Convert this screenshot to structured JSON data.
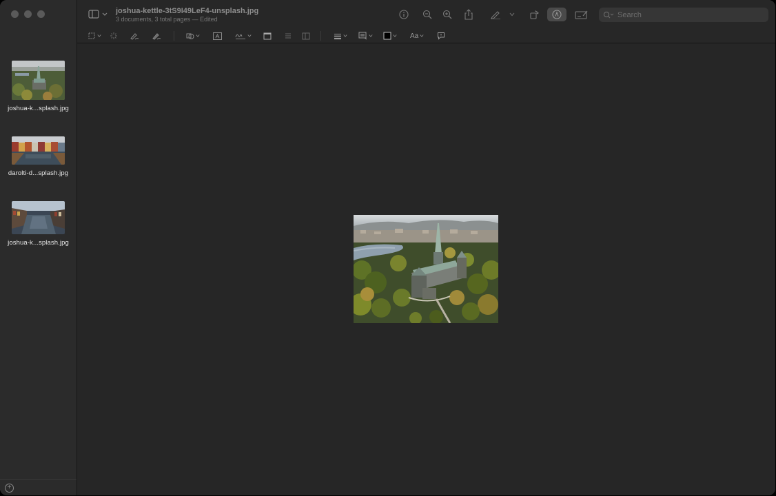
{
  "window": {
    "title": "joshua-kettle-3tS9I49LeF4-unsplash.jpg",
    "subtitle": "3 documents, 3 total pages — Edited"
  },
  "search": {
    "placeholder": "Search",
    "value": ""
  },
  "sidebar": {
    "items": [
      {
        "label": "joshua-k...splash.jpg"
      },
      {
        "label": "darolti-d...splash.jpg"
      },
      {
        "label": "joshua-k...splash.jpg"
      }
    ]
  },
  "markup": {
    "font_label": "Aa"
  },
  "colors": {
    "accent": "#4a4a4a",
    "background": "#272727",
    "border_color": "#000000"
  }
}
